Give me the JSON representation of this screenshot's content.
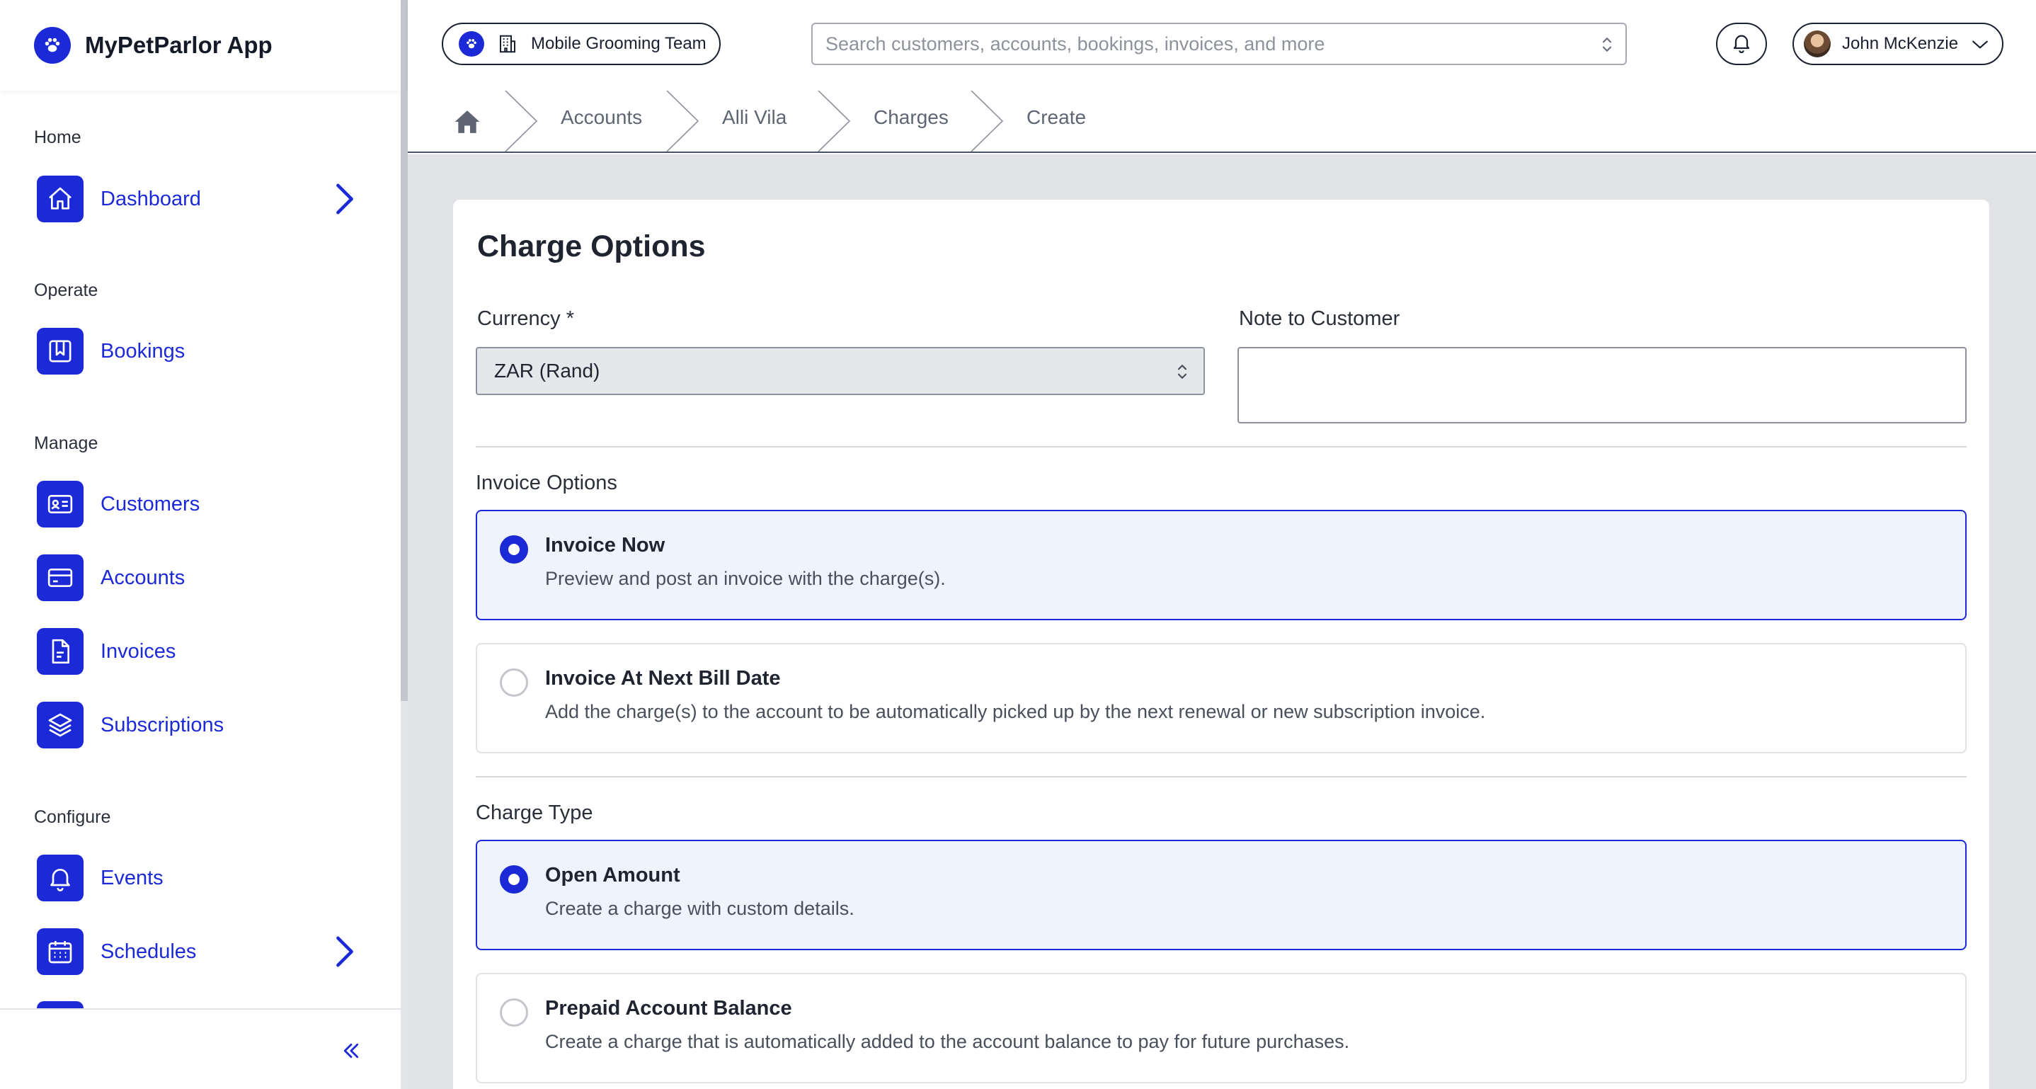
{
  "app": {
    "name": "MyPetParlor App",
    "logo_icon": "paw-icon",
    "accent_color": "#1b2ad6"
  },
  "sidebar": {
    "sections": [
      {
        "title": "Home",
        "items": [
          {
            "label": "Dashboard",
            "icon": "home-icon",
            "has_chevron": true
          }
        ]
      },
      {
        "title": "Operate",
        "items": [
          {
            "label": "Bookings",
            "icon": "bookmark-icon",
            "has_chevron": false
          }
        ]
      },
      {
        "title": "Manage",
        "items": [
          {
            "label": "Customers",
            "icon": "id-card-icon",
            "has_chevron": false
          },
          {
            "label": "Accounts",
            "icon": "credit-card-icon",
            "has_chevron": false
          },
          {
            "label": "Invoices",
            "icon": "document-icon",
            "has_chevron": false
          },
          {
            "label": "Subscriptions",
            "icon": "layers-icon",
            "has_chevron": false
          }
        ]
      },
      {
        "title": "Configure",
        "items": [
          {
            "label": "Events",
            "icon": "bell-icon",
            "has_chevron": false
          },
          {
            "label": "Schedules",
            "icon": "calendar-icon",
            "has_chevron": true
          }
        ]
      }
    ],
    "collapse_icon": "double-chevron-left-icon"
  },
  "topbar": {
    "team_label": "Mobile Grooming Team",
    "search_placeholder": "Search customers, accounts, bookings, invoices, and more",
    "user_name": "John McKenzie"
  },
  "breadcrumb": {
    "home_icon": "home-icon",
    "items": [
      "Accounts",
      "Alli Vila",
      "Charges",
      "Create"
    ]
  },
  "form": {
    "title": "Charge Options",
    "currency_label": "Currency *",
    "currency_value": "ZAR (Rand)",
    "note_label": "Note to Customer",
    "note_value": "",
    "invoice_options_label": "Invoice Options",
    "invoice_options": [
      {
        "title": "Invoice Now",
        "description": "Preview and post an invoice with the charge(s).",
        "selected": true
      },
      {
        "title": "Invoice At Next Bill Date",
        "description": "Add the charge(s) to the account to be automatically picked up by the next renewal or new subscription invoice.",
        "selected": false
      }
    ],
    "charge_type_label": "Charge Type",
    "charge_types": [
      {
        "title": "Open Amount",
        "description": "Create a charge with custom details.",
        "selected": true
      },
      {
        "title": "Prepaid Account Balance",
        "description": "Create a charge that is automatically added to the account balance to pay for future purchases.",
        "selected": false
      }
    ]
  }
}
